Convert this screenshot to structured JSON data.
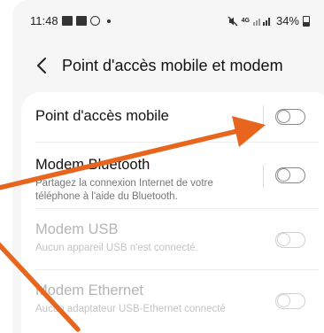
{
  "status_bar": {
    "time": "11:48",
    "network": "4G",
    "battery": "34%",
    "icons": [
      "gallery-icon",
      "screenshot-icon",
      "dnd-icon",
      "dot-icon",
      "mute-icon",
      "signal-icon",
      "battery-icon"
    ]
  },
  "header": {
    "back_icon": "chevron-left-icon",
    "title": "Point d'accès mobile et modem"
  },
  "rows": [
    {
      "title": "Point d'accès mobile",
      "subtitle": "",
      "enabled": true,
      "toggle_on": false
    },
    {
      "title": "Modem Bluetooth",
      "subtitle": "Partagez la connexion Internet de votre téléphone à l'aide du Bluetooth.",
      "enabled": true,
      "toggle_on": false
    },
    {
      "title": "Modem USB",
      "subtitle": "Aucun appareil USB n'est connecté.",
      "enabled": false,
      "toggle_on": false
    },
    {
      "title": "Modem Ethernet",
      "subtitle": "Aucun adaptateur USB-Ethernet connecté",
      "enabled": false,
      "toggle_on": false
    }
  ],
  "annotation": {
    "arrow_color": "#e8651e"
  }
}
